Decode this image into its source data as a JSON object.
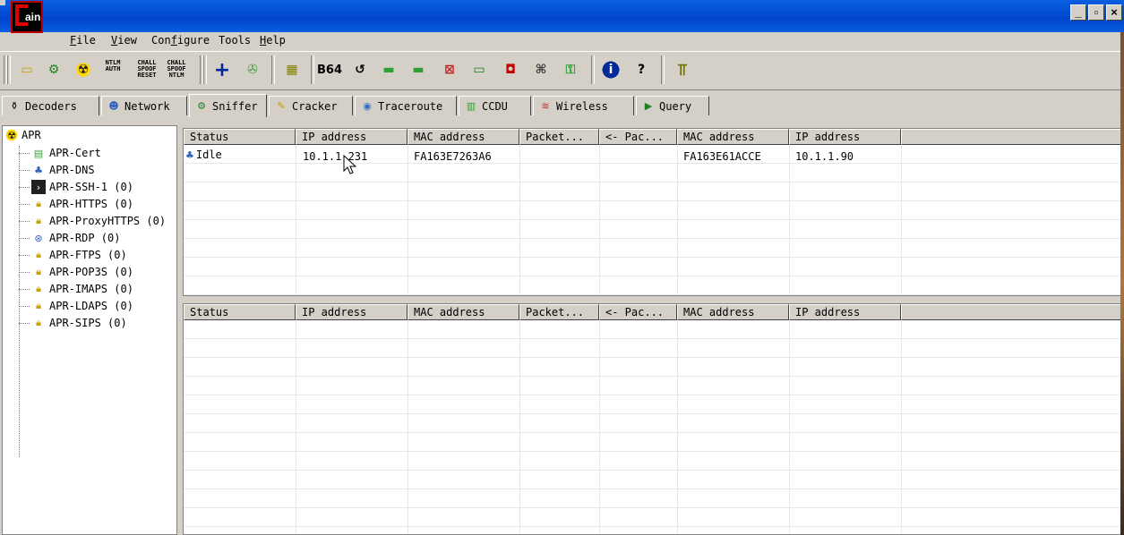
{
  "app": {
    "logo_text": "ain"
  },
  "window_controls": {
    "minimize": "_",
    "maximize": "▫",
    "close": "×"
  },
  "menu": [
    {
      "underline": "F",
      "rest": "ile"
    },
    {
      "underline": "V",
      "rest": "iew"
    },
    {
      "pre": "Con",
      "underline": "f",
      "rest": "igure"
    },
    {
      "pre": "Tools",
      "underline": "",
      "rest": ""
    },
    {
      "underline": "H",
      "rest": "elp"
    }
  ],
  "toolbar": {
    "ntlm_auth": "NTLM\nAUTH",
    "chall_spoof_reset": "CHALL\nSPOOF\nRESET",
    "chall_spoof_ntlm": "CHALL\nSPOOF\nNTLM",
    "b64": "B64"
  },
  "tabs": [
    "Decoders",
    "Network",
    "Sniffer",
    "Cracker",
    "Traceroute",
    "CCDU",
    "Wireless",
    "Query"
  ],
  "tree": {
    "root": "APR",
    "items": [
      "APR-Cert",
      "APR-DNS",
      "APR-SSH-1 (0)",
      "APR-HTTPS (0)",
      "APR-ProxyHTTPS (0)",
      "APR-RDP (0)",
      "APR-FTPS (0)",
      "APR-POP3S (0)",
      "APR-IMAPS (0)",
      "APR-LDAPS (0)",
      "APR-SIPS (0)"
    ]
  },
  "columns": [
    "Status",
    "IP address",
    "MAC address",
    "Packet...",
    "<- Pac...",
    "MAC address",
    "IP address"
  ],
  "top_rows": [
    {
      "status": "Idle",
      "ip1": "10.1.1.231",
      "mac1": "FA163E7263A6",
      "pkt_out": "",
      "pkt_in": "",
      "mac2": "FA163E61ACCE",
      "ip2": "10.1.1.90"
    }
  ]
}
